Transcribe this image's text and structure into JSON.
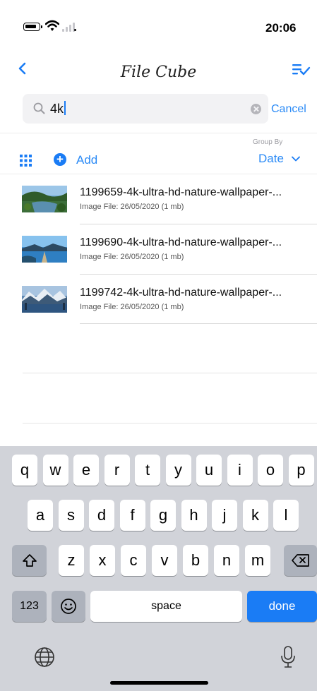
{
  "status": {
    "time": "20:06"
  },
  "nav": {
    "title": "File Cube"
  },
  "search": {
    "value": "4k",
    "cancel_label": "Cancel"
  },
  "toolbar": {
    "add_label": "Add",
    "group_by_caption": "Group By",
    "group_by_value": "Date"
  },
  "files": [
    {
      "name": "1199659-4k-ultra-hd-nature-wallpaper-...",
      "meta": "Image File: 26/05/2020 (1 mb)"
    },
    {
      "name": "1199690-4k-ultra-hd-nature-wallpaper-...",
      "meta": "Image File: 26/05/2020 (1 mb)"
    },
    {
      "name": "1199742-4k-ultra-hd-nature-wallpaper-...",
      "meta": "Image File: 26/05/2020 (1 mb)"
    }
  ],
  "keyboard": {
    "row1": [
      "q",
      "w",
      "e",
      "r",
      "t",
      "y",
      "u",
      "i",
      "o",
      "p"
    ],
    "row2": [
      "a",
      "s",
      "d",
      "f",
      "g",
      "h",
      "j",
      "k",
      "l"
    ],
    "row3": [
      "z",
      "x",
      "c",
      "v",
      "b",
      "n",
      "m"
    ],
    "numbers_label": "123",
    "space_label": "space",
    "done_label": "done"
  },
  "colors": {
    "accent": "#1a7cf5",
    "keyboard_bg": "#d1d3d9"
  },
  "icons": [
    "battery-icon",
    "wifi-icon",
    "signal-icon",
    "back-chevron-icon",
    "select-list-icon",
    "search-icon",
    "clear-icon",
    "grid-icon",
    "add-icon",
    "chevron-down-icon",
    "shift-icon",
    "delete-icon",
    "emoji-icon",
    "globe-icon",
    "microphone-icon"
  ]
}
